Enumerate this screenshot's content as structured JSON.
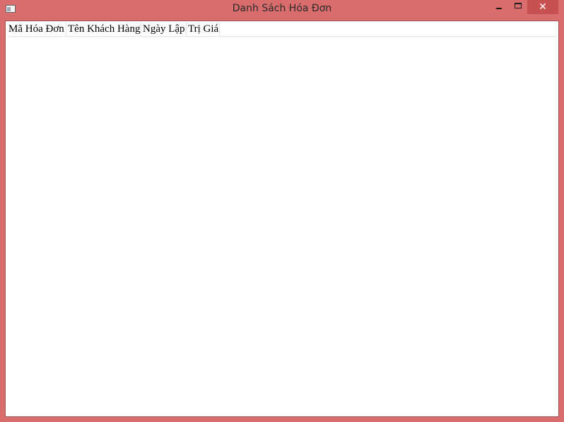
{
  "window": {
    "title": "Danh Sách Hóa Đơn",
    "close_glyph": "✕"
  },
  "list": {
    "columns": [
      {
        "label": "Mã Hóa Đơn"
      },
      {
        "label": "Tên Khách Hàng"
      },
      {
        "label": "Ngày Lập"
      },
      {
        "label": "Trị Giá"
      }
    ],
    "rows": []
  },
  "colors": {
    "frame": "#d96d6d",
    "close_button": "#c75050",
    "content_bg": "#ffffff"
  }
}
